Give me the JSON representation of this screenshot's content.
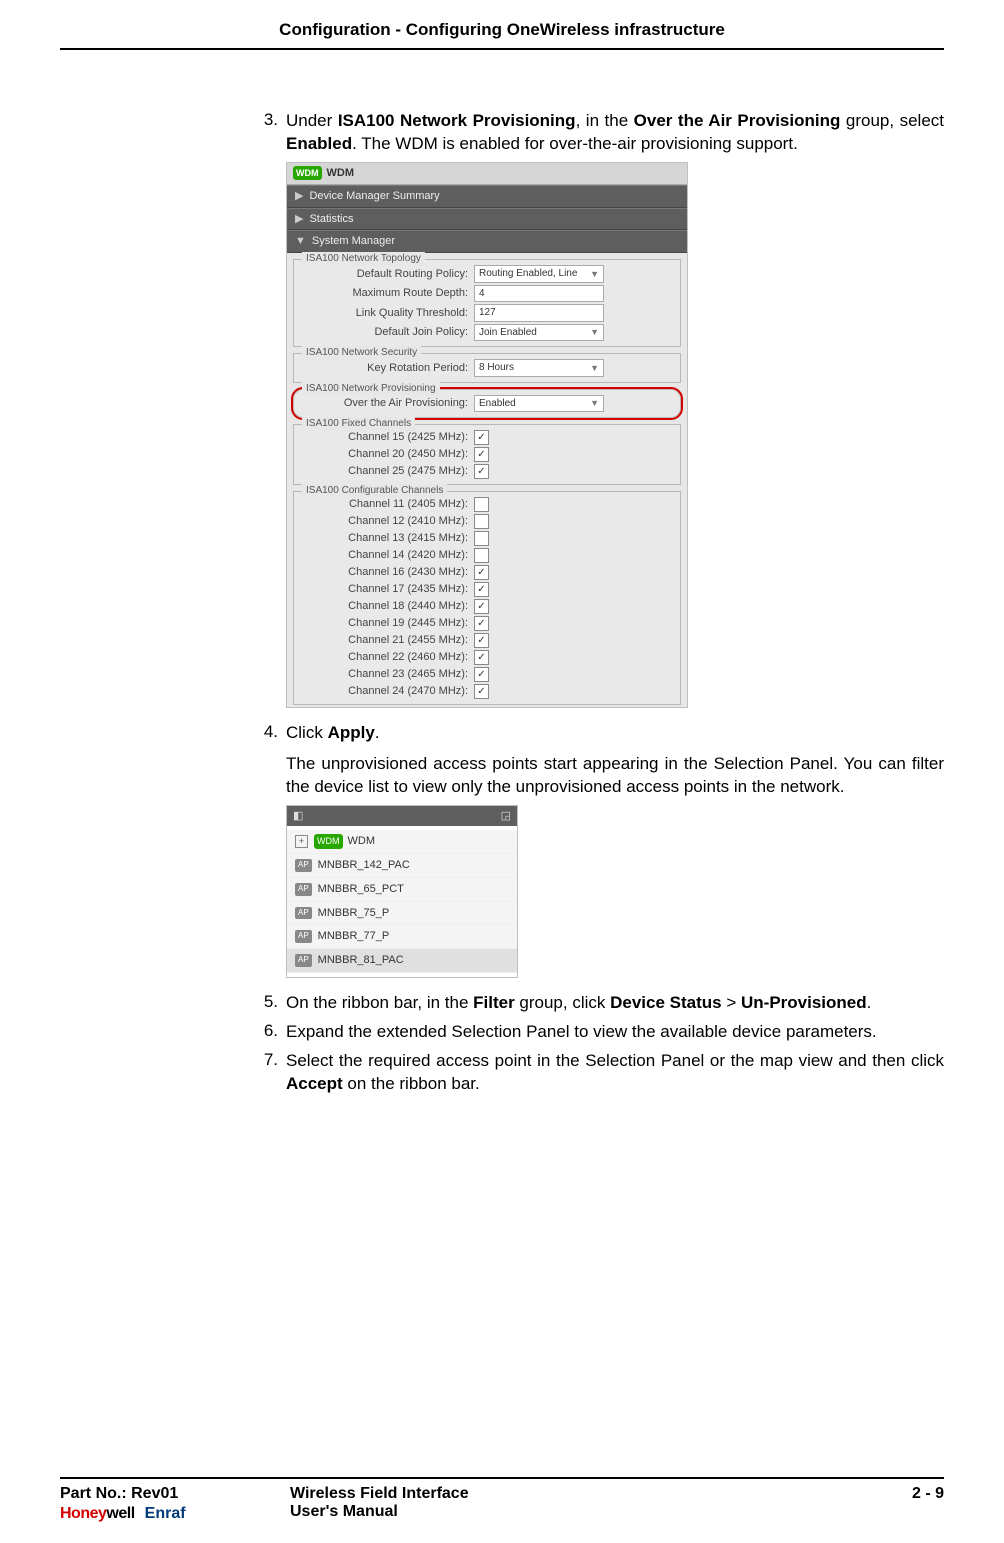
{
  "header": "Configuration - Configuring OneWireless infrastructure",
  "steps": {
    "s3": {
      "num": "3.",
      "pre": "Under ",
      "b1": "ISA100 Network Provisioning",
      "mid1": ", in the ",
      "b2": "Over the Air Provisioning",
      "mid2": " group, select ",
      "b3": "Enabled",
      "post": ". The WDM is enabled for over-the-air provisioning support."
    },
    "s4": {
      "num": "4.",
      "line1a": "Click ",
      "line1b": "Apply",
      "line1c": ".",
      "para": "The unprovisioned access points start appearing in the Selection Panel. You can filter the device list to view only the unprovisioned access points in the network."
    },
    "s5": {
      "num": "5.",
      "t1": "On the ribbon bar, in the ",
      "b1": "Filter",
      "t2": " group, click ",
      "b2": "Device Status",
      "t3": " > ",
      "b3": "Un-Provisioned",
      "t4": "."
    },
    "s6": {
      "num": "6.",
      "text": "Expand the extended Selection Panel to view the available device parameters."
    },
    "s7": {
      "num": "7.",
      "t1": "Select the required access point in the Selection Panel or the map view and then click ",
      "b1": "Accept",
      "t2": " on the ribbon bar."
    }
  },
  "shot1": {
    "title": "WDM",
    "nav": [
      "Device Manager Summary",
      "Statistics",
      "System Manager"
    ],
    "topology": {
      "legend": "ISA100 Network Topology",
      "rows": [
        {
          "label": "Default Routing Policy:",
          "value": "Routing Enabled, Line",
          "type": "dd"
        },
        {
          "label": "Maximum Route Depth:",
          "value": "4",
          "type": "txt"
        },
        {
          "label": "Link Quality Threshold:",
          "value": "127",
          "type": "txt"
        },
        {
          "label": "Default Join Policy:",
          "value": "Join Enabled",
          "type": "dd"
        }
      ]
    },
    "security": {
      "legend": "ISA100 Network Security",
      "rows": [
        {
          "label": "Key Rotation Period:",
          "value": "8 Hours",
          "type": "dd"
        }
      ]
    },
    "provisioning": {
      "legend": "ISA100 Network Provisioning",
      "rows": [
        {
          "label": "Over the Air Provisioning:",
          "value": "Enabled",
          "type": "dd"
        }
      ]
    },
    "fixed": {
      "legend": "ISA100 Fixed Channels",
      "rows": [
        {
          "label": "Channel 15 (2425 MHz):",
          "checked": true
        },
        {
          "label": "Channel 20 (2450 MHz):",
          "checked": true
        },
        {
          "label": "Channel 25 (2475 MHz):",
          "checked": true
        }
      ]
    },
    "config": {
      "legend": "ISA100 Configurable Channels",
      "rows": [
        {
          "label": "Channel 11 (2405 MHz):",
          "checked": false
        },
        {
          "label": "Channel 12 (2410 MHz):",
          "checked": false
        },
        {
          "label": "Channel 13 (2415 MHz):",
          "checked": false
        },
        {
          "label": "Channel 14 (2420 MHz):",
          "checked": false
        },
        {
          "label": "Channel 16 (2430 MHz):",
          "checked": true
        },
        {
          "label": "Channel 17 (2435 MHz):",
          "checked": true
        },
        {
          "label": "Channel 18 (2440 MHz):",
          "checked": true
        },
        {
          "label": "Channel 19 (2445 MHz):",
          "checked": true
        },
        {
          "label": "Channel 21 (2455 MHz):",
          "checked": true
        },
        {
          "label": "Channel 22 (2460 MHz):",
          "checked": true
        },
        {
          "label": "Channel 23 (2465 MHz):",
          "checked": true
        },
        {
          "label": "Channel 24 (2470 MHz):",
          "checked": true
        }
      ]
    }
  },
  "shot2": {
    "wdm": "WDM",
    "items": [
      "MNBBR_142_PAC",
      "MNBBR_65_PCT",
      "MNBBR_75_P",
      "MNBBR_77_P",
      "MNBBR_81_PAC"
    ]
  },
  "footer": {
    "part": "Part No.: Rev01",
    "title1": "Wireless Field Interface",
    "title2": "User's Manual",
    "page": "2 - 9",
    "brand1": "Honeywell",
    "brand2": "Enraf"
  }
}
